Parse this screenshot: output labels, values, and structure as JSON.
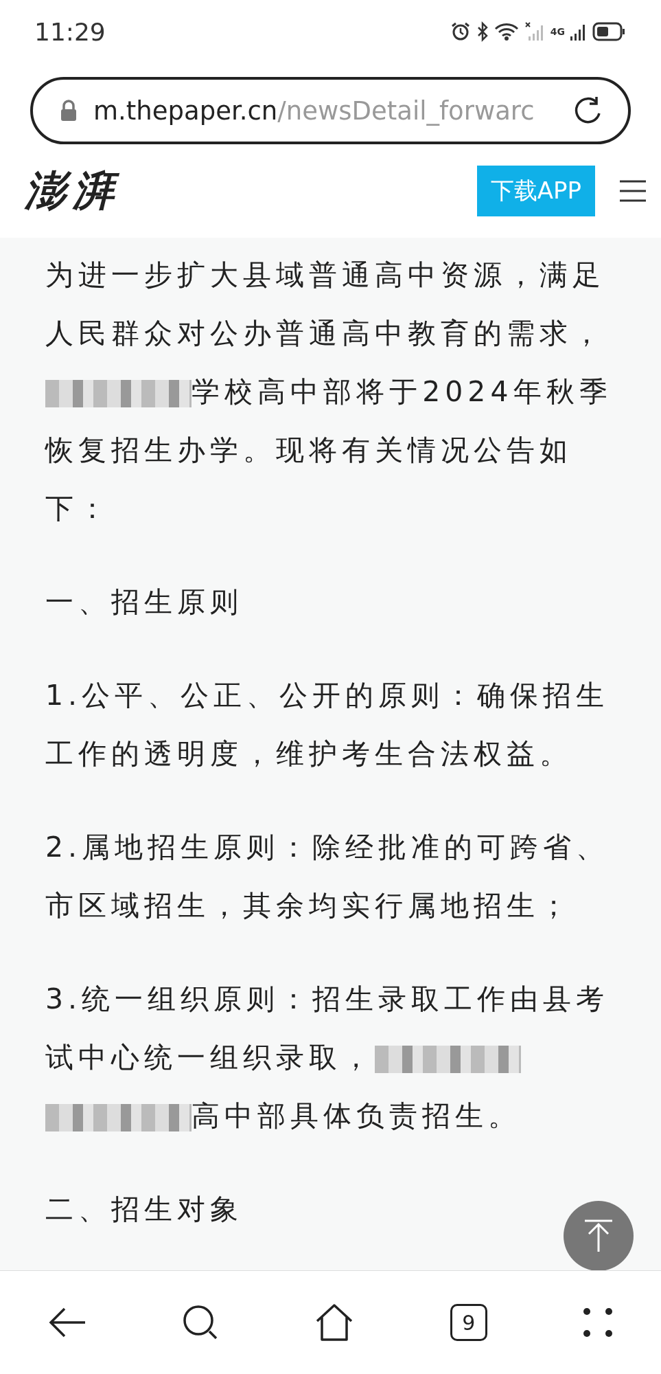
{
  "status_bar": {
    "time": "11:29",
    "network": "4G"
  },
  "address_bar": {
    "host": "m.thepaper.cn",
    "path": "/newsDetail_forwarc"
  },
  "site_header": {
    "logo": "澎湃",
    "download_button": "下载APP"
  },
  "article": {
    "paragraphs": [
      {
        "parts": [
          {
            "kind": "text",
            "text": "为进一步扩大县域普通高中资源，满足人民群众对公办普通高中教育的需求，"
          },
          {
            "kind": "redacted"
          },
          {
            "kind": "text",
            "text": "学校高中部将于2024年秋季恢复招生办学。现将有关情况公告如下："
          }
        ]
      },
      {
        "parts": [
          {
            "kind": "text",
            "text": "一、招生原则"
          }
        ]
      },
      {
        "parts": [
          {
            "kind": "text",
            "text": "1.公平、公正、公开的原则：确保招生工作的透明度，维护考生合法权益。"
          }
        ]
      },
      {
        "parts": [
          {
            "kind": "text",
            "text": "2.属地招生原则：除经批准的可跨省、市区域招生，其余均实行属地招生；"
          }
        ]
      },
      {
        "parts": [
          {
            "kind": "text",
            "text": "3.统一组织原则：招生录取工作由县考试中心统一组织录取，"
          },
          {
            "kind": "redacted"
          },
          {
            "kind": "redacted"
          },
          {
            "kind": "text",
            "text": "高中部具体负责招生。"
          }
        ]
      },
      {
        "parts": [
          {
            "kind": "text",
            "text": "二、招生对象"
          }
        ]
      }
    ]
  },
  "bottom_nav": {
    "tab_count": "9"
  }
}
